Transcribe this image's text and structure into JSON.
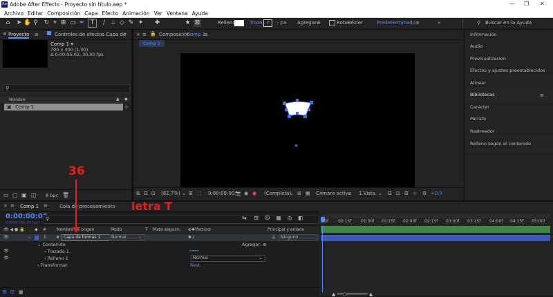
{
  "window": {
    "app_icon": "Ae",
    "title": "Adobe After Effects - Proyecto sin título.aep *",
    "controls": [
      "minimize-icon",
      "maximize-icon",
      "close-icon"
    ]
  },
  "menu": [
    "Archivo",
    "Editar",
    "Composición",
    "Capa",
    "Efecto",
    "Animación",
    "Ver",
    "Ventana",
    "Ayuda"
  ],
  "toolbar": {
    "fill_label": "Relleno",
    "stroke_label": "Trazo",
    "stroke_px": "- px",
    "add_label": "Agregar:",
    "rotobezier_label": "RotoBézier",
    "workspace": "Predeterminado",
    "search_placeholder": "Buscar en la Ayuda"
  },
  "project_panel": {
    "tab_project": "Proyecto",
    "tab_effects": "Controles de efectos Capa de",
    "comp_name": "Comp 1 ▾",
    "comp_size": "700 x 400 (1,00)",
    "comp_duration": "Δ 0:00:05:02, 30,00 fps",
    "col_name": "Nombre",
    "item": "Comp 1",
    "bpc": "8 bpc"
  },
  "comp_panel": {
    "tab": "Composición",
    "tab_name": "Comp 1",
    "subtab": "Comp 1",
    "zoom": "(82,7%)",
    "timecode": "0:00:00:00",
    "resolution": "(Completa)",
    "camera": "Cámara activa",
    "views": "1 Vista",
    "exposure": "+0,0"
  },
  "right_panel": {
    "items": [
      "Información",
      "Audio",
      "Previsualización",
      "Efectos y ajustes preestablecidos",
      "Alinear",
      "Bibliotecas",
      "Carácter",
      "Párrafo",
      "Rastreador",
      "Relleno según el contenido"
    ]
  },
  "timeline": {
    "tab_comp": "Comp 1",
    "tab_render": "Cola de procesamiento",
    "timecode": "0:00:00:00",
    "timecode_sub": "00000 (30,00 fps)",
    "col_source": "Nombre de origen",
    "col_mode": "Modo",
    "col_t": "T",
    "col_matte": "Mate seguim.",
    "col_parent": "Principal y enlace",
    "layer_num": "1",
    "layer_name": "Capa de formas 1",
    "layer_mode": "Normal",
    "layer_parent": "Ninguno",
    "contents": "Contenido",
    "add_label": "Agregar:",
    "trazado": "Trazado 1",
    "relleno": "Relleno 1",
    "relleno_mode": "Normal",
    "transform": "Transformar",
    "reset": "Rest.",
    "ruler": [
      "0f",
      "00:15f",
      "01:00f",
      "01:15f",
      "02:00f",
      "02:15f",
      "03:00f",
      "03:15f",
      "04:00f",
      "04:15f",
      "05:00f"
    ]
  },
  "annotations": {
    "number": "36",
    "letter": "letra T",
    "color": "#e0221b"
  }
}
